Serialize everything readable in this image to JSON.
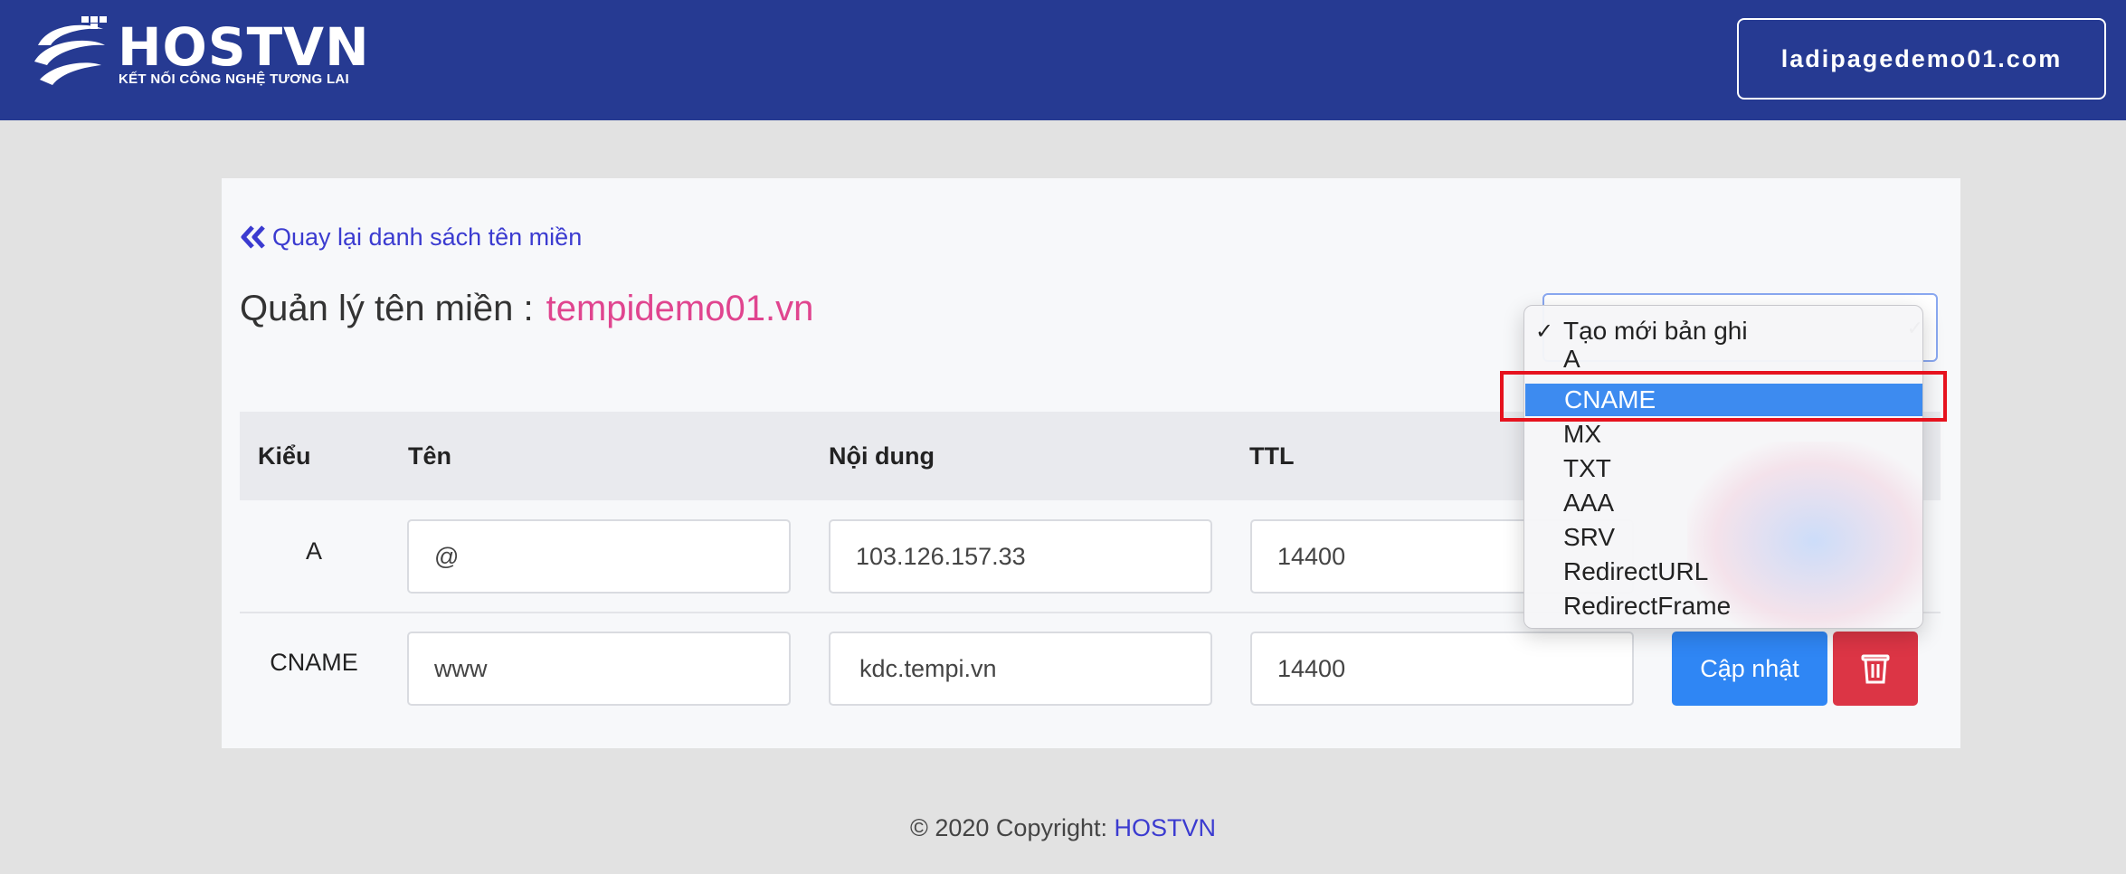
{
  "header": {
    "logo_name": "HOSTVN",
    "logo_tagline": "KẾT NỐI CÔNG NGHỆ TƯƠNG LAI",
    "domain_button": "ladipagedemo01.com",
    "bg_color": "#263a92"
  },
  "page": {
    "back_link": "Quay lại danh sách tên miền",
    "title_label": "Quản lý tên miền :",
    "title_domain": "tempidemo01.vn"
  },
  "table": {
    "headers": {
      "type": "Kiểu",
      "name": "Tên",
      "content": "Nội dung",
      "ttl": "TTL"
    },
    "rows": [
      {
        "type": "A",
        "name": "@",
        "content": "103.126.157.33",
        "ttl": "14400"
      },
      {
        "type": "CNAME",
        "name": "www",
        "content": "kdc.tempi.vn",
        "ttl": "14400"
      }
    ]
  },
  "actions": {
    "update_label": "Cập nhật",
    "delete_icon": "trash-icon"
  },
  "dropdown": {
    "options": [
      "Tạo mới bản ghi",
      "A",
      "CNAME",
      "MX",
      "TXT",
      "AAA",
      "SRV",
      "RedirectURL",
      "RedirectFrame"
    ],
    "checked": "Tạo mới bản ghi",
    "highlighted": "CNAME"
  },
  "footer": {
    "copyright": "© 2020 Copyright:",
    "brand": "HOSTVN"
  }
}
